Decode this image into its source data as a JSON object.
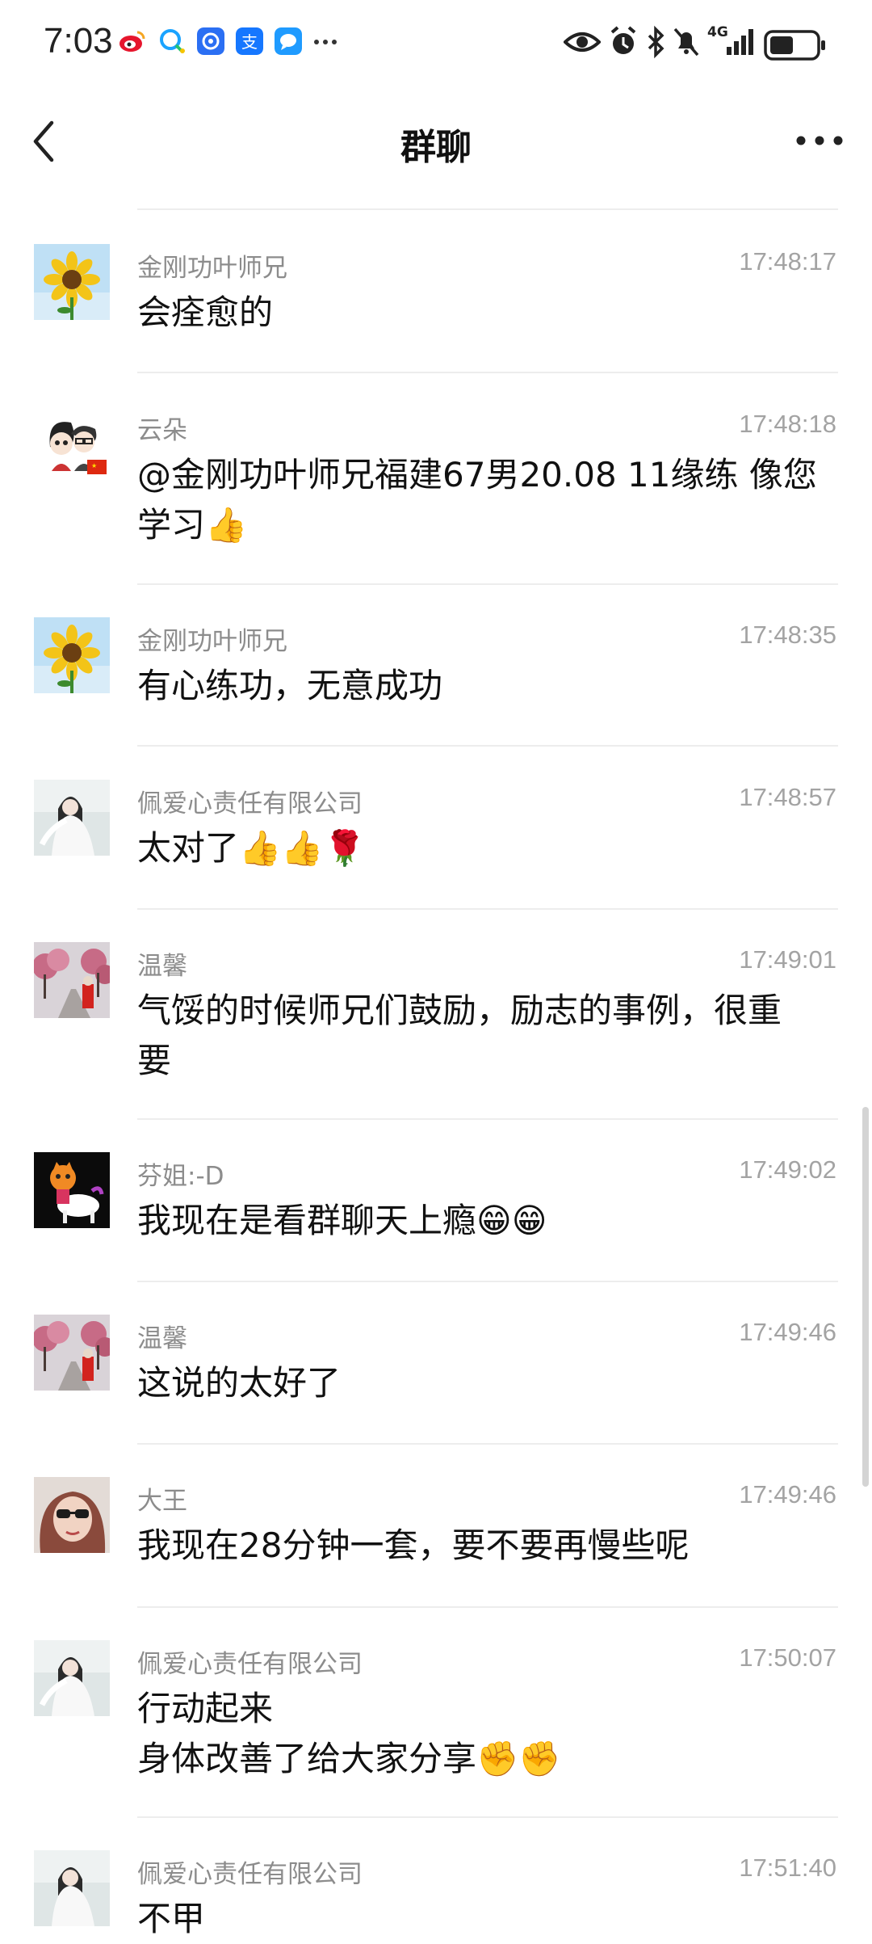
{
  "status_bar": {
    "time": "7:03",
    "app_icons": [
      "weibo-icon",
      "qq-browser-icon",
      "app-icon",
      "alipay-icon",
      "message-icon",
      "more-notifications-icon"
    ],
    "system_icons": [
      "eye-icon",
      "alarm-icon",
      "bluetooth-icon",
      "mute-icon",
      "signal-4g-icon",
      "battery-icon"
    ],
    "network": "4G"
  },
  "header": {
    "title": "群聊",
    "back_icon": "back-chevron-icon",
    "more_icon": "more-dots-icon"
  },
  "messages": [
    {
      "avatar": "sunflower",
      "name": "金刚功叶师兄",
      "time": "17:48:17",
      "lines": [
        "会痊愈的"
      ]
    },
    {
      "avatar": "cartoon-couple",
      "name": "云朵",
      "time": "17:48:18",
      "lines": [
        "@金刚功叶师兄福建67男20.08 11缘练 像您",
        "学习👍"
      ]
    },
    {
      "avatar": "sunflower",
      "name": "金刚功叶师兄",
      "time": "17:48:35",
      "lines": [
        "有心练功，无意成功"
      ]
    },
    {
      "avatar": "woman-white-dress",
      "name": "佩爱心责任有限公司",
      "time": "17:48:57",
      "lines": [
        "太对了👍👍🌹"
      ]
    },
    {
      "avatar": "blossom-road",
      "name": "温馨",
      "time": "17:49:01",
      "lines": [
        "气馁的时候师兄们鼓励，励志的事例，很重",
        "要"
      ]
    },
    {
      "avatar": "tiger-cartoon",
      "name": "芬姐:-D",
      "time": "17:49:02",
      "lines": [
        "我现在是看群聊天上瘾😁😁"
      ]
    },
    {
      "avatar": "blossom-road",
      "name": "温馨",
      "time": "17:49:46",
      "lines": [
        "这说的太好了"
      ]
    },
    {
      "avatar": "woman-sunglasses",
      "name": "大王",
      "time": "17:49:46",
      "lines": [
        "我现在28分钟一套，要不要再慢些呢"
      ]
    },
    {
      "avatar": "woman-white-dress",
      "name": "佩爱心责任有限公司",
      "time": "17:50:07",
      "lines": [
        "行动起来",
        "身体改善了给大家分享✊✊"
      ]
    },
    {
      "avatar": "woman-white-dress",
      "name": "佩爱心责任有限公司",
      "time": "17:51:40",
      "lines": [
        "不甲"
      ]
    }
  ]
}
